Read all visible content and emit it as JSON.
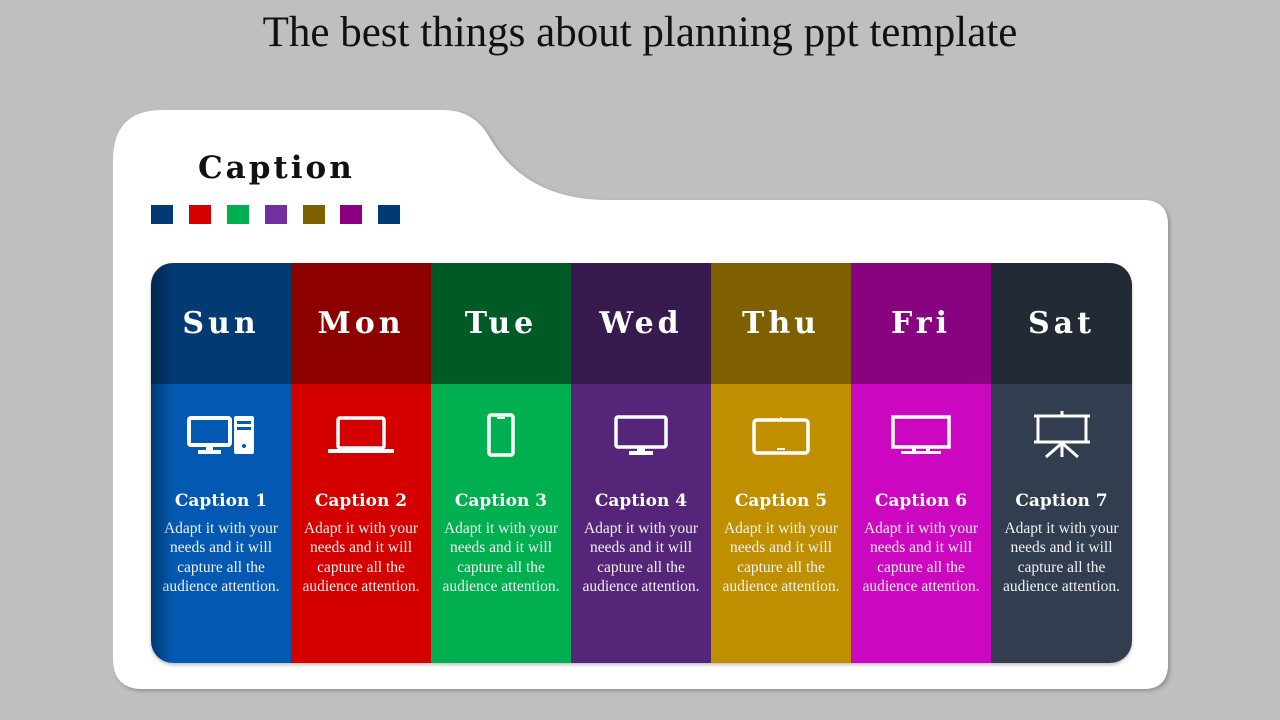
{
  "title": "The best things about planning ppt template",
  "caption_heading": "Caption",
  "swatches": [
    "#023a74",
    "#d50000",
    "#00b050",
    "#7030a0",
    "#7f6000",
    "#8b0083",
    "#023a74"
  ],
  "days": [
    {
      "label": "Sun",
      "head_color": "#023a73",
      "body_color": "#0359b1",
      "icon": "desktop-computer-icon",
      "caption": "Caption 1",
      "text": "Adapt it with your needs and it will capture all the audience attention."
    },
    {
      "label": "Mon",
      "head_color": "#8c0000",
      "body_color": "#d40000",
      "icon": "laptop-icon",
      "caption": "Caption 2",
      "text": "Adapt it with your needs and it will capture all the audience attention."
    },
    {
      "label": "Tue",
      "head_color": "#005a26",
      "body_color": "#00b050",
      "icon": "smartphone-icon",
      "caption": "Caption 3",
      "text": "Adapt it with your needs and it will capture all the audience attention."
    },
    {
      "label": "Wed",
      "head_color": "#371a4f",
      "body_color": "#542578",
      "icon": "monitor-icon",
      "caption": "Caption 4",
      "text": "Adapt it with your needs and it will capture all the audience attention."
    },
    {
      "label": "Thu",
      "head_color": "#7f6000",
      "body_color": "#bf8f00",
      "icon": "tablet-icon",
      "caption": "Caption 5",
      "text": "Adapt it with your needs and it will capture all the audience attention."
    },
    {
      "label": "Fri",
      "head_color": "#880380",
      "body_color": "#cc07c0",
      "icon": "tv-icon",
      "caption": "Caption 6",
      "text": "Adapt it with your needs and it will capture all the audience attention."
    },
    {
      "label": "Sat",
      "head_color": "#222a36",
      "body_color": "#323e4f",
      "icon": "presentation-board-icon",
      "caption": "Caption 7",
      "text": "Adapt it with your needs and it will capture all the audience attention."
    }
  ]
}
